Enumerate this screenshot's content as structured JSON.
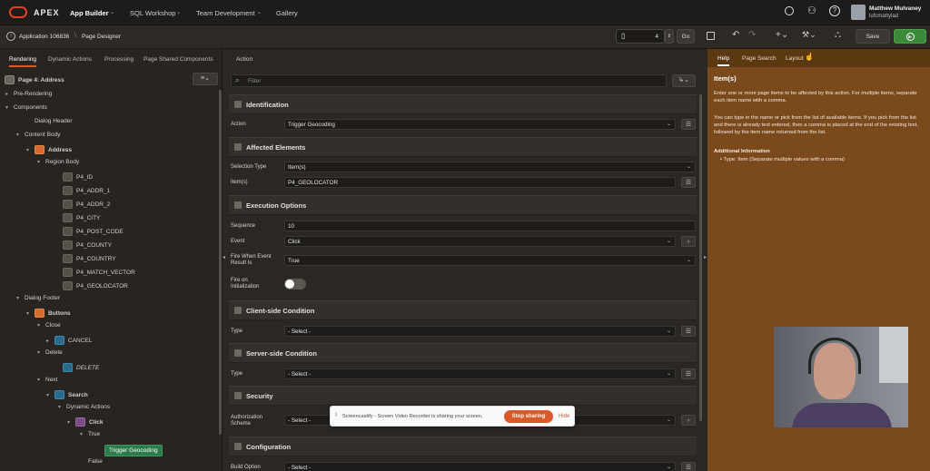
{
  "topnav": {
    "brand": "APEX",
    "menus": [
      "App Builder",
      "SQL Workshop",
      "Team Development",
      "Gallery"
    ],
    "user_name": "Matthew Mulvaney",
    "user_handle": "lufcmattylad"
  },
  "toolbar": {
    "app_crumb": "Application 106836",
    "page_crumb": "Page Designer",
    "page_number": "4",
    "go_label": "Go",
    "save_label": "Save"
  },
  "left": {
    "tabs": [
      "Rendering",
      "Dynamic Actions",
      "Processing",
      "Page Shared Components"
    ],
    "page_title": "Page 4: Address",
    "tree": [
      {
        "label": "Pre-Rendering"
      },
      {
        "label": "Components"
      },
      {
        "label": "Dialog Header"
      },
      {
        "label": "Content Body"
      },
      {
        "label": "Address"
      },
      {
        "label": "Region Body"
      },
      {
        "label": "P4_ID"
      },
      {
        "label": "P4_ADDR_1"
      },
      {
        "label": "P4_ADDR_2"
      },
      {
        "label": "P4_CITY"
      },
      {
        "label": "P4_POST_CODE"
      },
      {
        "label": "P4_COUNTY"
      },
      {
        "label": "P4_COUNTRY"
      },
      {
        "label": "P4_MATCH_VECTOR"
      },
      {
        "label": "P4_GEOLOCATOR"
      },
      {
        "label": "Dialog Footer"
      },
      {
        "label": "Buttons"
      },
      {
        "label": "Close"
      },
      {
        "label": "CANCEL"
      },
      {
        "label": "Delete"
      },
      {
        "label": "DELETE"
      },
      {
        "label": "Next"
      },
      {
        "label": "Search"
      },
      {
        "label": "Dynamic Actions"
      },
      {
        "label": "Click"
      },
      {
        "label": "True"
      },
      {
        "label": "Trigger Geocoding"
      },
      {
        "label": "False"
      }
    ]
  },
  "middle": {
    "header": "Action",
    "filter_placeholder": "Filter",
    "sections": {
      "identification": "Identification",
      "affected": "Affected Elements",
      "execution": "Execution Options",
      "client": "Client-side Condition",
      "server": "Server-side Condition",
      "security": "Security",
      "configuration": "Configuration"
    },
    "fields": {
      "action_label": "Action",
      "action_value": "Trigger Geocoding",
      "selection_type_label": "Selection Type",
      "selection_type_value": "Item(s)",
      "items_label": "Item(s)",
      "items_value": "P4_GEOLOCATOR",
      "sequence_label": "Sequence",
      "sequence_value": "10",
      "event_label": "Event",
      "event_value": "Click",
      "fire_when_label": "Fire When Event Result Is",
      "fire_when_value": "True",
      "fire_init_label": "Fire on Initialization",
      "client_type_label": "Type",
      "client_type_value": "- Select -",
      "server_type_label": "Type",
      "server_type_value": "- Select -",
      "auth_label": "Authorization Scheme",
      "auth_value": "- Select -",
      "build_label": "Build Option",
      "build_value": "- Select -"
    }
  },
  "right": {
    "tabs": [
      "Help",
      "Page Search",
      "Layout"
    ],
    "title": "Item(s)",
    "para1": "Enter one or more page items to be affected by this action. For multiple items, separate each item name with a comma.",
    "para2": "You can type in the name or pick from the list of available items. If you pick from the list and there is already text entered, then a comma is placed at the end of the existing text, followed by the item name returned from the list.",
    "additional_heading": "Additional Information",
    "bullet": "Type: Item (Separate multiple values with a comma)"
  },
  "toast": {
    "message": "Screencastify - Screen Video Recorder is sharing your screen.",
    "stop_label": "Stop sharing",
    "hide_label": "Hide"
  },
  "colors": {
    "accent": "#d85a2a",
    "help_bg": "#7a4a1c",
    "run_button": "#3a8a3a",
    "selected_node": "#2d7a4a"
  }
}
